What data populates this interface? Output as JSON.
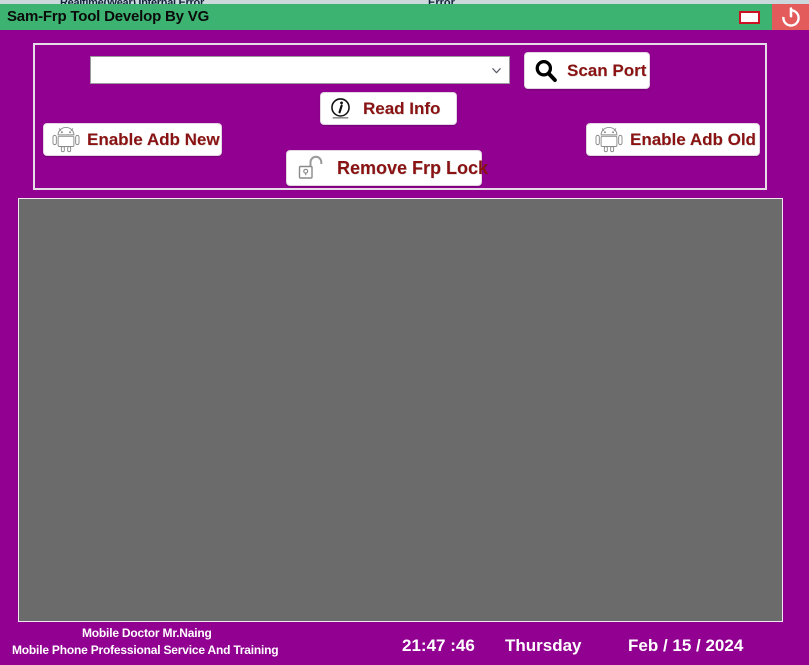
{
  "background_window": {
    "title_fragment": "Realtime(Wear) Internal Error",
    "right_fragment": "Error"
  },
  "titlebar": {
    "title": "Sam-Frp Tool Develop By VG",
    "minimize_icon": "minimize-icon",
    "close_icon": "power-close-icon",
    "bg_color": "#3cb371",
    "text_color": "#0b0b0b"
  },
  "theme": {
    "window_bg": "#910091",
    "panel_border": "#e7dbe7",
    "button_bg": "#ffffff",
    "button_text": "#8b1212",
    "log_bg": "#6b6b6b",
    "accent_green": "#3cb371",
    "close_red": "#e35b5b"
  },
  "controls": {
    "port_combo": {
      "value": "",
      "placeholder": "",
      "arrow_icon": "chevron-down-icon"
    },
    "buttons": [
      {
        "id": "scan-port",
        "label": "Scan Port",
        "icon": "magnifier-icon"
      },
      {
        "id": "read-info",
        "label": "Read Info",
        "icon": "info-circle-icon"
      },
      {
        "id": "enable-adb-new",
        "label": "Enable Adb New",
        "icon": "android-robot-icon"
      },
      {
        "id": "enable-adb-old",
        "label": "Enable Adb Old",
        "icon": "android-robot-icon"
      },
      {
        "id": "remove-frp",
        "label": "Remove Frp Lock",
        "icon": "open-padlock-icon"
      }
    ]
  },
  "log": {
    "content": "",
    "placeholder": ""
  },
  "statusbar": {
    "brand_line_1": "Mobile Doctor Mr.Naing",
    "brand_line_2": "Mobile Phone Professional Service And Training",
    "time": "21:47 :46",
    "day": "Thursday",
    "date": "Feb / 15 / 2024"
  }
}
